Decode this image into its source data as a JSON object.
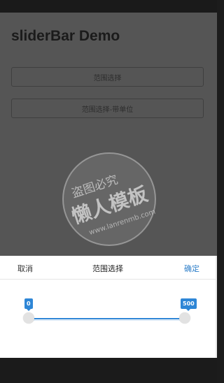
{
  "page": {
    "title": "sliderBar Demo",
    "buttons": [
      "范围选择",
      "范围选择-带单位"
    ]
  },
  "watermark": {
    "line1": "盗图必究",
    "line2": "懒人模板",
    "line3": "www.lanrenmb.com"
  },
  "sheet": {
    "cancel_label": "取消",
    "title": "范围选择",
    "confirm_label": "确定"
  },
  "slider": {
    "min_value": "0",
    "max_value": "500",
    "accent_color": "#2e86d6"
  }
}
